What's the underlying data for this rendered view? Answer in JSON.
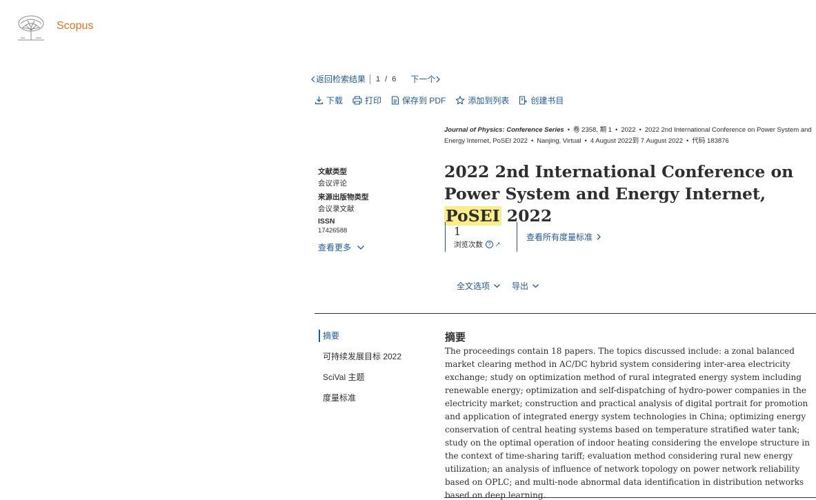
{
  "brand": {
    "name": "Scopus",
    "color": "#e9711c",
    "logo_icon": "elsevier-tree-icon"
  },
  "nav": {
    "back_label": "返回检索结果",
    "page_current": "1",
    "page_total": "6",
    "next_label": "下一个"
  },
  "toolbar": [
    {
      "label": "下载",
      "icon": "download-icon"
    },
    {
      "label": "打印",
      "icon": "print-icon"
    },
    {
      "label": "保存到 PDF",
      "icon": "pdf-icon"
    },
    {
      "label": "添加到列表",
      "icon": "star-icon"
    },
    {
      "label": "创建书目",
      "icon": "bibliography-icon"
    }
  ],
  "source": {
    "journal": "Journal of Physics: Conference Series",
    "volume": "卷 2358, 期 1",
    "year": "2022",
    "conference": "2022 2nd International Conference on Power System and Energy Internet, PoSEI 2022",
    "location": "Nanjing, Virtual",
    "dates": "4 August 2022到 7 August 2022",
    "code": "代码 183876"
  },
  "meta": {
    "doc_type_label": "文献类型",
    "doc_type_value": "会议评论",
    "source_type_label": "来源出版物类型",
    "source_type_value": "会议录文献",
    "issn_label": "ISSN",
    "issn_value": "17426588",
    "more_label": "查看更多"
  },
  "title": {
    "before": "2022 2nd International Conference on Power System and Energy Internet, ",
    "highlight": "PoSEI",
    "after": " 2022",
    "highlight_color": "#fdec8a"
  },
  "metrics": {
    "views_count": "1",
    "views_label": "浏览次数",
    "all_metrics_label": "查看所有度量标准"
  },
  "options": {
    "fulltext_label": "全文选项",
    "export_label": "导出"
  },
  "sidebar": [
    {
      "label": "摘要",
      "active": true
    },
    {
      "label": "可持续发展目标 2022",
      "active": false
    },
    {
      "label": "SciVal 主题",
      "active": false
    },
    {
      "label": "度量标准",
      "active": false
    }
  ],
  "abstract": {
    "heading": "摘要",
    "text": "The proceedings contain 18 papers. The topics discussed include: a zonal balanced market clearing method in AC/DC hybrid system considering inter-area electricity exchange; study on optimization method of rural integrated energy system including renewable energy; optimization and self-dispatching of hydro-power companies in the electricity market; construction and practical analysis of digital portrait for promotion and application of integrated energy system technologies in China; optimizing energy conservation of central heating systems based on temperature stratified water tank; study on the optimal operation of indoor heating considering the envelope structure in the context of time-sharing tariff; evaluation method considering rural new energy utilization; an analysis of influence of network topology on power network reliability based on OPLC; and multi-node abnormal data identification in distribution networks based on deep learning."
  },
  "colors": {
    "link": "#1f5a96",
    "text": "#2e2e2e"
  }
}
